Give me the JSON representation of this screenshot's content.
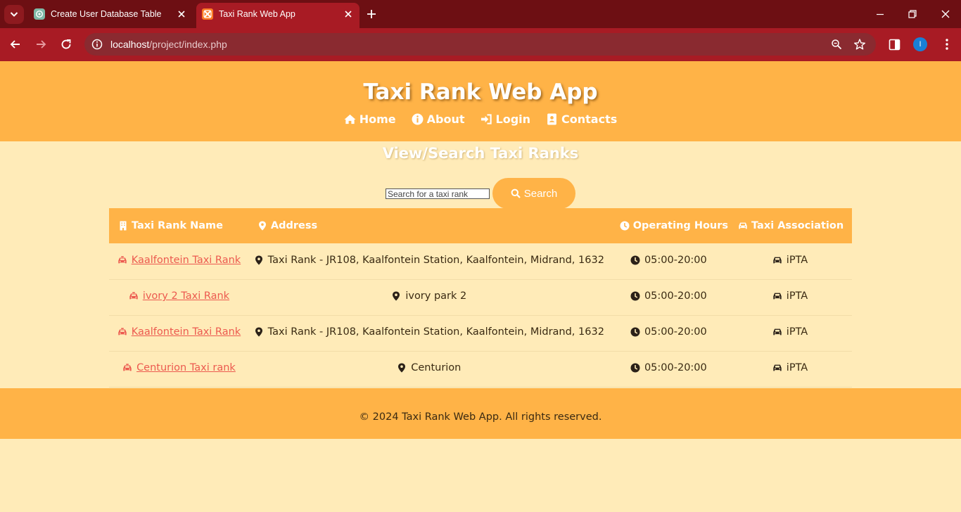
{
  "browser": {
    "tabs": [
      {
        "title": "Create User Database Table",
        "active": false,
        "icon": "chatgpt-icon"
      },
      {
        "title": "Taxi Rank Web App",
        "active": true,
        "icon": "xampp-icon"
      }
    ],
    "url_host": "localhost",
    "url_path": "/project/index.php",
    "profile_initial": "I"
  },
  "header": {
    "title": "Taxi Rank Web App",
    "nav": [
      {
        "label": "Home",
        "icon": "home-icon"
      },
      {
        "label": "About",
        "icon": "info-circle-icon"
      },
      {
        "label": "Login",
        "icon": "sign-in-icon"
      },
      {
        "label": "Contacts",
        "icon": "address-book-icon"
      }
    ]
  },
  "main": {
    "title": "View/Search Taxi Ranks",
    "search": {
      "placeholder": "Search for a taxi rank",
      "value": "",
      "button_label": "Search"
    },
    "table": {
      "columns": [
        {
          "label": "Taxi Rank Name",
          "icon": "building-icon"
        },
        {
          "label": "Address",
          "icon": "map-marker-icon"
        },
        {
          "label": "Operating Hours",
          "icon": "clock-icon"
        },
        {
          "label": "Taxi Association",
          "icon": "car-icon"
        }
      ],
      "rows": [
        {
          "name": "Kaalfontein Taxi Rank",
          "address": "Taxi Rank - JR108, Kaalfontein Station, Kaalfontein, Midrand, 1632",
          "hours": "05:00-20:00",
          "association": "iPTA"
        },
        {
          "name": "ivory 2 Taxi Rank",
          "address": "ivory park 2",
          "hours": "05:00-20:00",
          "association": "iPTA"
        },
        {
          "name": "Kaalfontein Taxi Rank",
          "address": "Taxi Rank - JR108, Kaalfontein Station, Kaalfontein, Midrand, 1632",
          "hours": "05:00-20:00",
          "association": "iPTA"
        },
        {
          "name": "Centurion Taxi rank",
          "address": "Centurion",
          "hours": "05:00-20:00",
          "association": "iPTA"
        }
      ]
    }
  },
  "footer": {
    "text": "© 2024 Taxi Rank Web App. All rights reserved."
  },
  "colors": {
    "tabstrip": "#6d0f13",
    "toolbar": "#a81b24",
    "header_bg": "#ffb347",
    "page_bg": "#ffebb8",
    "link": "#ec5a4f",
    "text": "#3a2a12"
  }
}
